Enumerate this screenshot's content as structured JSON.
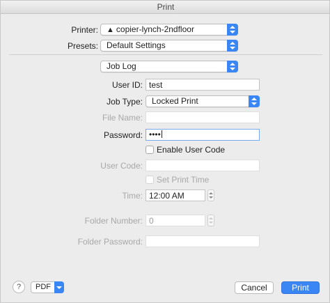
{
  "window": {
    "title": "Print"
  },
  "printer": {
    "label": "Printer:",
    "value": "copier-lynch-2ndfloor",
    "icon": "warning-icon",
    "icon_glyph": "▲"
  },
  "presets": {
    "label": "Presets:",
    "value": "Default Settings"
  },
  "section": {
    "value": "Job Log"
  },
  "form": {
    "user_id": {
      "label": "User ID:",
      "value": "test"
    },
    "job_type": {
      "label": "Job Type:",
      "value": "Locked Print"
    },
    "file_name": {
      "label": "File Name:",
      "value": ""
    },
    "password": {
      "label": "Password:",
      "value": "••••"
    },
    "enable_user_code": {
      "label": "Enable User Code",
      "checked": false
    },
    "user_code": {
      "label": "User Code:",
      "value": ""
    },
    "set_print_time": {
      "label": "Set Print Time",
      "checked": false,
      "disabled": true
    },
    "time": {
      "label": "Time:",
      "value": "12:00 AM"
    },
    "folder_number": {
      "label": "Folder Number:",
      "value": "0"
    },
    "folder_password": {
      "label": "Folder Password:",
      "value": ""
    }
  },
  "footer": {
    "help_label": "?",
    "pdf_label": "PDF",
    "cancel_label": "Cancel",
    "print_label": "Print"
  },
  "colors": {
    "accent": "#3b86f5",
    "disabled_text": "#a8a8a8",
    "background": "#ececec"
  }
}
